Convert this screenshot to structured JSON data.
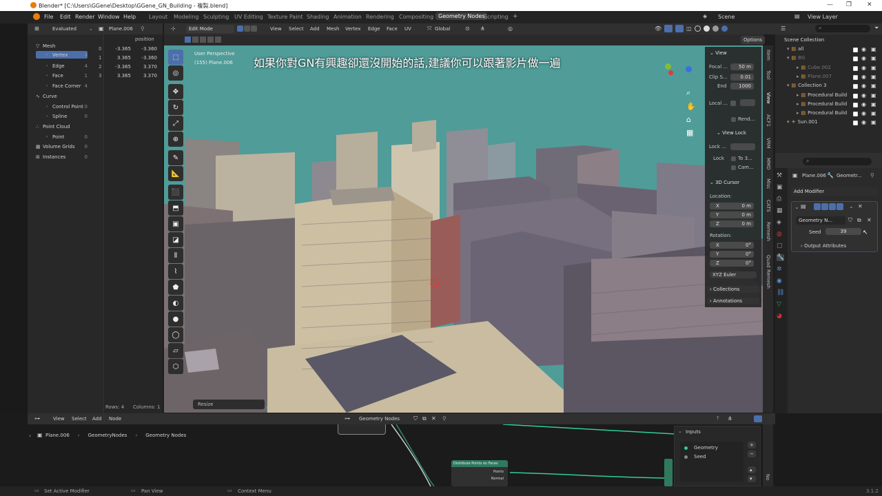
{
  "window": {
    "title": "Blender* [C:\\Users\\GGene\\Desktop\\GGene_GN_Building - 複製.blend]"
  },
  "menu": [
    "File",
    "Edit",
    "Render",
    "Window",
    "Help"
  ],
  "workspaces": [
    "Layout",
    "Modeling",
    "Sculpting",
    "UV Editing",
    "Texture Paint",
    "Shading",
    "Animation",
    "Rendering",
    "Compositing",
    "Geometry Nodes",
    "Scripting"
  ],
  "active_workspace": "Geometry Nodes",
  "scene": "Scene",
  "view_layer": "View Layer",
  "spreadsheet": {
    "mode": "Evaluated",
    "object": "Plane.006",
    "column": "position",
    "tree": [
      {
        "label": "Mesh",
        "count": ""
      },
      {
        "label": "Vertex",
        "count": "4"
      },
      {
        "label": "Edge",
        "count": "4"
      },
      {
        "label": "Face",
        "count": "1"
      },
      {
        "label": "Face Corner",
        "count": "4"
      },
      {
        "label": "Curve",
        "count": ""
      },
      {
        "label": "Control Point",
        "count": "0"
      },
      {
        "label": "Spline",
        "count": "0"
      },
      {
        "label": "Point Cloud",
        "count": ""
      },
      {
        "label": "Point",
        "count": "0"
      },
      {
        "label": "Volume Grids",
        "count": "0"
      },
      {
        "label": "Instances",
        "count": "0"
      }
    ],
    "rows": [
      {
        "i": "0",
        "x": "-3.365",
        "y": "-3.360"
      },
      {
        "i": "1",
        "x": "3.365",
        "y": "-3.360"
      },
      {
        "i": "2",
        "x": "-3.365",
        "y": "3.370"
      },
      {
        "i": "3",
        "x": "3.365",
        "y": "3.370"
      }
    ],
    "footer": {
      "rows": "Rows: 4",
      "columns": "Columns: 1"
    }
  },
  "viewport_header": {
    "mode": "Edit Mode",
    "menus": [
      "View",
      "Select",
      "Add",
      "Mesh",
      "Vertex",
      "Edge",
      "Face",
      "UV"
    ],
    "orientation": "Global",
    "options": "Options"
  },
  "viewport": {
    "perspective": "User Perspective",
    "object_info": "(155) Plane.006",
    "subtitle": "如果你對GN有興趣卻還沒開始的話,建議你可以跟著影片做一遍",
    "resize": "Resize"
  },
  "npanel": {
    "view_title": "View",
    "focal_label": "Focal ...",
    "focal_val": "50 m",
    "clip_label": "Clip S...",
    "clip_val": "0.01",
    "end_label": "End",
    "end_val": "1000",
    "local_label": "Local ...",
    "render_label": "Rend...",
    "viewlock_title": "View Lock",
    "lock_label": "Lock ...",
    "lock2_label": "Lock",
    "to3_label": "To 3...",
    "cam_label": "Cam...",
    "cursor_title": "3D Cursor",
    "location_label": "Location:",
    "x": "X",
    "y": "Y",
    "z": "Z",
    "loc_x": "0 m",
    "loc_y": "0 m",
    "loc_z": "0 m",
    "rotation_label": "Rotation:",
    "rot_x": "0°",
    "rot_y": "0°",
    "rot_z": "0°",
    "euler": "XYZ Euler",
    "collections": "Collections",
    "annotations": "Annotations"
  },
  "side_tabs": [
    "Item",
    "Tool",
    "View",
    "ACF1",
    "VRM",
    "MMD",
    "Misc",
    "CATS",
    "Remesh",
    "Quad Remesh"
  ],
  "outliner": {
    "title": "Scene Collection",
    "items": [
      {
        "label": "all",
        "indent": 0
      },
      {
        "label": "BG",
        "indent": 0
      },
      {
        "label": "Cube.002",
        "indent": 1
      },
      {
        "label": "Plane.007",
        "indent": 1
      },
      {
        "label": "Collection 3",
        "indent": 0
      },
      {
        "label": "Procedural Build",
        "indent": 1
      },
      {
        "label": "Procedural Build",
        "indent": 1
      },
      {
        "label": "Procedural Build",
        "indent": 1
      },
      {
        "label": "Sun.001",
        "indent": 0
      }
    ]
  },
  "properties": {
    "breadcrumb_obj": "Plane.006",
    "breadcrumb_mod": "Geometr...",
    "add_modifier": "Add Modifier",
    "modifier_name": "Geometry N...",
    "seed_label": "Seed",
    "seed_value": "39",
    "output_attr": "Output Attributes"
  },
  "node_editor": {
    "menus": [
      "View",
      "Select",
      "Add",
      "Node"
    ],
    "tree_name": "Geometry Nodes",
    "breadcrumb": [
      "Plane.006",
      "GeometryNodes",
      "Geometry Nodes"
    ],
    "node_title": "Distribute Points on Faces",
    "node_out1": "Points",
    "node_out2": "Normal",
    "inputs_title": "Inputs",
    "inputs": [
      "Geometry",
      "Seed"
    ],
    "tab_no": "No"
  },
  "status": {
    "left": "Set Active Modifier",
    "mid": "Pan View",
    "right": "Context Menu",
    "version": "3.1.2"
  },
  "colors": {
    "accent": "#4c6faa",
    "viewport_sky": "#4e9a96",
    "node_header": "#2f7a5e",
    "ws_active": "#3d3d3d"
  }
}
